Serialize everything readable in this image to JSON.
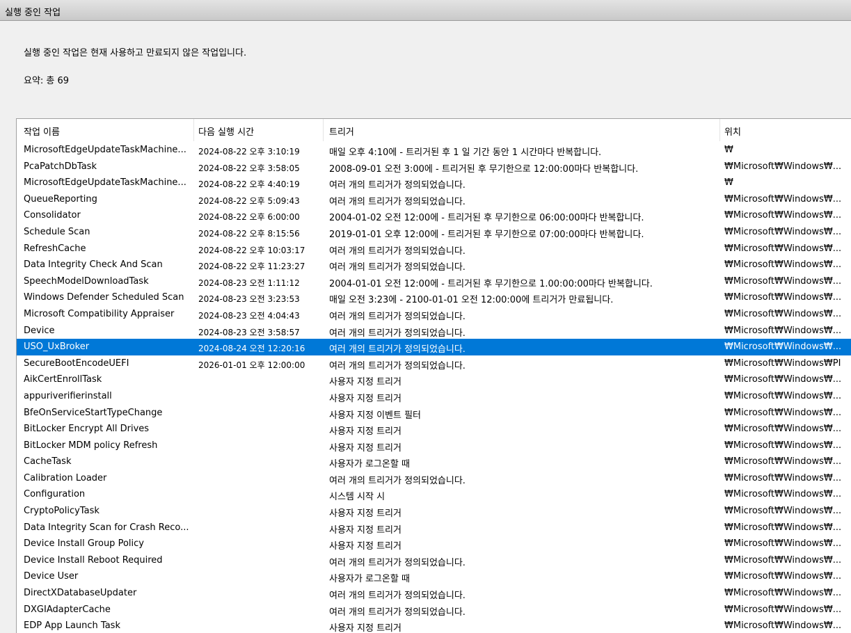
{
  "window": {
    "title": "실행 중인 작업"
  },
  "description": "실행 중인 작업은 현재 사용하고 만료되지 않은 작업입니다.",
  "summary": "요약: 총 69",
  "columns": [
    "작업 이름",
    "다음 실행 시간",
    "트리거",
    "위치"
  ],
  "selected_row": 12,
  "rows": [
    [
      "MicrosoftEdgeUpdateTaskMachine...",
      "2024-08-22 오후 3:10:19",
      "매일 오후 4:10에 - 트리거된 후 1 일 기간 동안 1 시간마다 반복합니다.",
      "₩"
    ],
    [
      "PcaPatchDbTask",
      "2024-08-22 오후 3:58:05",
      "2008-09-01 오전 3:00에 - 트리거된 후 무기한으로 12:00:00마다 반복합니다.",
      "₩Microsoft₩Windows₩..."
    ],
    [
      "MicrosoftEdgeUpdateTaskMachine...",
      "2024-08-22 오후 4:40:19",
      "여러 개의 트리거가 정의되었습니다.",
      "₩"
    ],
    [
      "QueueReporting",
      "2024-08-22 오후 5:09:43",
      "여러 개의 트리거가 정의되었습니다.",
      "₩Microsoft₩Windows₩..."
    ],
    [
      "Consolidator",
      "2024-08-22 오후 6:00:00",
      "2004-01-02 오전 12:00에 - 트리거된 후 무기한으로 06:00:00마다 반복합니다.",
      "₩Microsoft₩Windows₩..."
    ],
    [
      "Schedule Scan",
      "2024-08-22 오후 8:15:56",
      "2019-01-01 오후 12:00에 - 트리거된 후 무기한으로 07:00:00마다 반복합니다.",
      "₩Microsoft₩Windows₩..."
    ],
    [
      "RefreshCache",
      "2024-08-22 오후 10:03:17",
      "여러 개의 트리거가 정의되었습니다.",
      "₩Microsoft₩Windows₩..."
    ],
    [
      "Data Integrity Check And Scan",
      "2024-08-22 오후 11:23:27",
      "여러 개의 트리거가 정의되었습니다.",
      "₩Microsoft₩Windows₩..."
    ],
    [
      "SpeechModelDownloadTask",
      "2024-08-23 오전 1:11:12",
      "2004-01-01 오전 12:00에 - 트리거된 후 무기한으로 1.00:00:00마다 반복합니다.",
      "₩Microsoft₩Windows₩..."
    ],
    [
      "Windows Defender Scheduled Scan",
      "2024-08-23 오전 3:23:53",
      "매일 오전 3:23에 - 2100-01-01 오전 12:00:00에 트리거가 만료됩니다.",
      "₩Microsoft₩Windows₩..."
    ],
    [
      "Microsoft Compatibility Appraiser",
      "2024-08-23 오전 4:04:43",
      "여러 개의 트리거가 정의되었습니다.",
      "₩Microsoft₩Windows₩..."
    ],
    [
      "Device",
      "2024-08-23 오전 3:58:57",
      "여러 개의 트리거가 정의되었습니다.",
      "₩Microsoft₩Windows₩..."
    ],
    [
      "USO_UxBroker",
      "2024-08-24 오전 12:20:16",
      "여러 개의 트리거가 정의되었습니다.",
      "₩Microsoft₩Windows₩..."
    ],
    [
      "SecureBootEncodeUEFI",
      "2026-01-01 오후 12:00:00",
      "여러 개의 트리거가 정의되었습니다.",
      "₩Microsoft₩Windows₩PI"
    ],
    [
      "AikCertEnrollTask",
      "",
      "사용자 지정 트리거",
      "₩Microsoft₩Windows₩..."
    ],
    [
      "appuriverifierinstall",
      "",
      "사용자 지정 트리거",
      "₩Microsoft₩Windows₩..."
    ],
    [
      "BfeOnServiceStartTypeChange",
      "",
      "사용자 지정 이벤트 필터",
      "₩Microsoft₩Windows₩..."
    ],
    [
      "BitLocker Encrypt All Drives",
      "",
      "사용자 지정 트리거",
      "₩Microsoft₩Windows₩..."
    ],
    [
      "BitLocker MDM policy Refresh",
      "",
      "사용자 지정 트리거",
      "₩Microsoft₩Windows₩..."
    ],
    [
      "CacheTask",
      "",
      "사용자가 로그온할 때",
      "₩Microsoft₩Windows₩..."
    ],
    [
      "Calibration Loader",
      "",
      "여러 개의 트리거가 정의되었습니다.",
      "₩Microsoft₩Windows₩..."
    ],
    [
      "Configuration",
      "",
      "시스템 시작 시",
      "₩Microsoft₩Windows₩..."
    ],
    [
      "CryptoPolicyTask",
      "",
      "사용자 지정 트리거",
      "₩Microsoft₩Windows₩..."
    ],
    [
      "Data Integrity Scan for Crash Reco...",
      "",
      "사용자 지정 트리거",
      "₩Microsoft₩Windows₩..."
    ],
    [
      "Device Install Group Policy",
      "",
      "사용자 지정 트리거",
      "₩Microsoft₩Windows₩..."
    ],
    [
      "Device Install Reboot Required",
      "",
      "여러 개의 트리거가 정의되었습니다.",
      "₩Microsoft₩Windows₩..."
    ],
    [
      "Device User",
      "",
      "사용자가 로그온할 때",
      "₩Microsoft₩Windows₩..."
    ],
    [
      "DirectXDatabaseUpdater",
      "",
      "여러 개의 트리거가 정의되었습니다.",
      "₩Microsoft₩Windows₩..."
    ],
    [
      "DXGIAdapterCache",
      "",
      "여러 개의 트리거가 정의되었습니다.",
      "₩Microsoft₩Windows₩..."
    ],
    [
      "EDP App Launch Task",
      "",
      "사용자 지정 트리거",
      "₩Microsoft₩Windows₩..."
    ]
  ]
}
